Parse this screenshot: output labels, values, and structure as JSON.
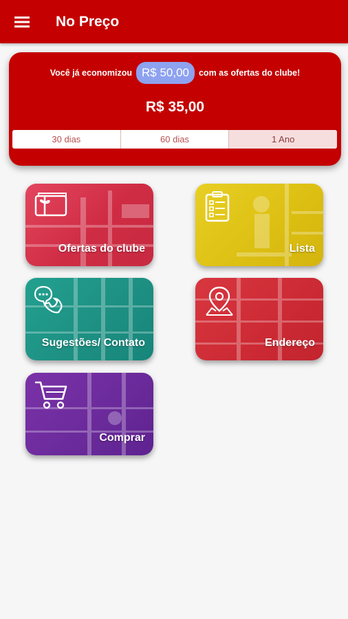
{
  "appbar": {
    "title": "No Preço",
    "menu_icon": "hamburger-menu-icon"
  },
  "savings": {
    "prefix": "Você já economizou",
    "amount": "R$ 50,00",
    "suffix": "com as ofertas do clube!",
    "total": "R$ 35,00",
    "periods": [
      "30 dias",
      "60 dias",
      "1 Ano"
    ],
    "selected_period": "1 Ano"
  },
  "tiles": [
    {
      "label": "Ofertas do clube",
      "icon": "gift-card-icon",
      "color": "#d6344a"
    },
    {
      "label": "Lista",
      "icon": "clipboard-list-icon",
      "color": "#e0c416"
    },
    {
      "label": "Sugestões/ Contato",
      "icon": "chat-phone-icon",
      "color": "#1f9488"
    },
    {
      "label": "Endereço",
      "icon": "map-pin-icon",
      "color": "#cf2a34"
    },
    {
      "label": "Comprar",
      "icon": "shopping-cart-icon",
      "color": "#6a2a9a"
    }
  ],
  "colors": {
    "primary": "#c40000",
    "saved_pill": "#8ea2f0",
    "background": "#f6f6f6"
  }
}
